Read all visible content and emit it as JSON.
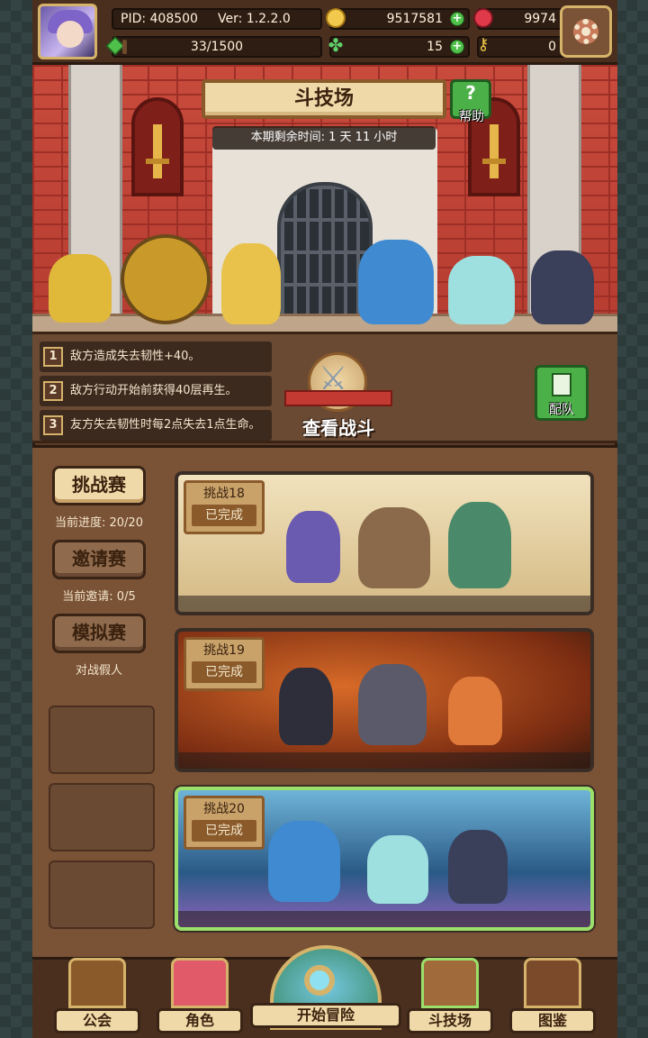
{
  "header": {
    "pid_label": "PID: 408500",
    "version_label": "Ver: 1.2.2.0",
    "coins": "9517581",
    "gems": "9974",
    "exp": "33/1500",
    "exp_fraction": 0.022,
    "clovers": "15",
    "keys": "0"
  },
  "arena": {
    "title": "斗技场",
    "help_label": "帮助",
    "timer": "本期剩余时间: 1 天 11 小时"
  },
  "rules": [
    {
      "num": "1",
      "text": "敌方造成失去韧性+40。"
    },
    {
      "num": "2",
      "text": "敌方行动开始前获得40层再生。"
    },
    {
      "num": "3",
      "text": "友方失去韧性时每2点失去1点生命。"
    }
  ],
  "actions": {
    "view_battle": "查看战斗",
    "team": "配队"
  },
  "modes": [
    {
      "label": "挑战赛",
      "note": "当前进度: 20/20",
      "active": true
    },
    {
      "label": "邀请赛",
      "note": "当前邀请: 0/5",
      "active": false
    },
    {
      "label": "模拟赛",
      "note": "对战假人",
      "active": false
    }
  ],
  "challenges": [
    {
      "name": "挑战18",
      "status": "已完成"
    },
    {
      "name": "挑战19",
      "status": "已完成"
    },
    {
      "name": "挑战20",
      "status": "已完成"
    }
  ],
  "nav": {
    "guild": "公会",
    "character": "角色",
    "adventure": "开始冒险",
    "arena": "斗技场",
    "codex": "图鉴"
  },
  "colors": {
    "accent_green": "#4cb048",
    "selected_outline": "#9be06a",
    "panel_brown": "#7a5236"
  },
  "icons": [
    "avatar",
    "coin-icon",
    "gem-icon",
    "plus-icon",
    "clover-icon",
    "key-icon",
    "gear-icon",
    "help-icon",
    "crossed-swords-icon",
    "team-icon",
    "guild-icon",
    "character-icon",
    "adventure-icon",
    "arena-icon",
    "codex-icon"
  ]
}
